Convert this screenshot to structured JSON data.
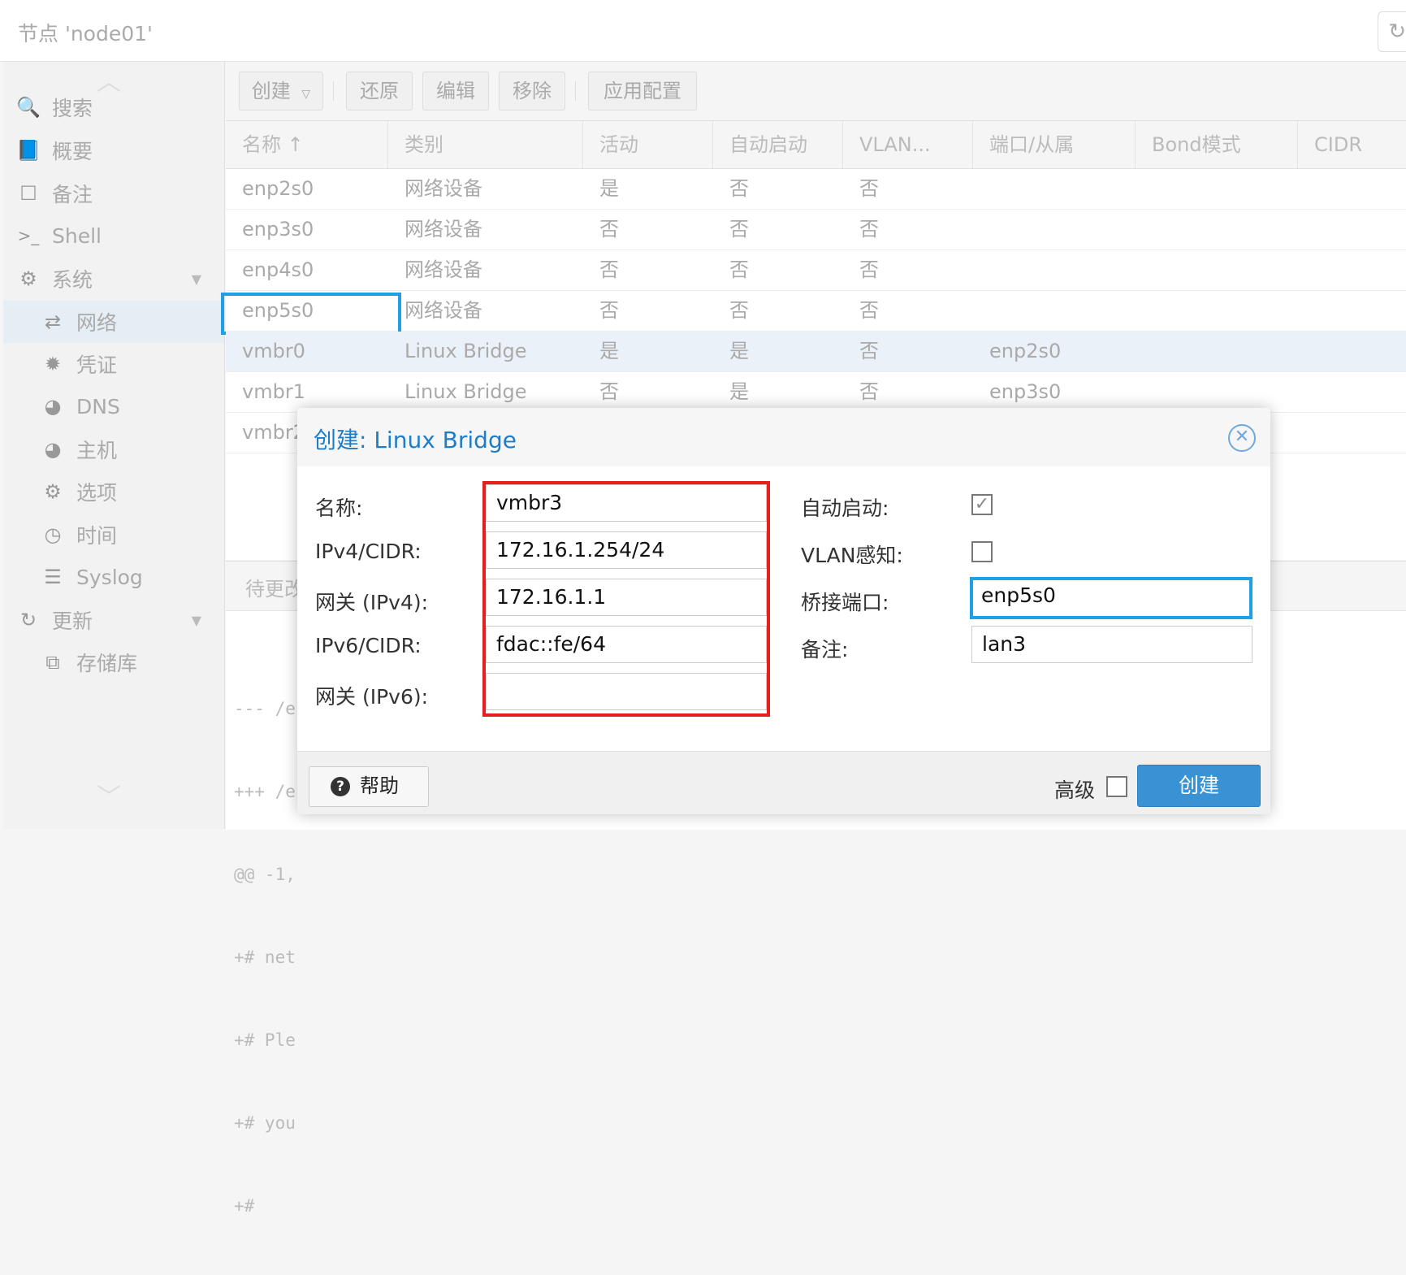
{
  "header": {
    "title": "节点 'node01'",
    "reload_icon": "↻"
  },
  "nav": {
    "items": [
      {
        "icon": "🔍",
        "icon_name": "search-icon",
        "label": "搜索"
      },
      {
        "icon": "📘",
        "icon_name": "book-icon",
        "label": "概要"
      },
      {
        "icon": "☐",
        "icon_name": "note-icon",
        "label": "备注"
      },
      {
        "icon": ">_",
        "icon_name": "terminal-icon",
        "label": "Shell"
      },
      {
        "icon": "⚙",
        "icon_name": "cogs-icon",
        "label": "系统"
      },
      {
        "icon": "⇄",
        "icon_name": "exchange-icon",
        "label": "网络"
      },
      {
        "icon": "✹",
        "icon_name": "certificate-icon",
        "label": "凭证"
      },
      {
        "icon": "◕",
        "icon_name": "globe-icon",
        "label": "DNS"
      },
      {
        "icon": "◕",
        "icon_name": "globe-icon",
        "label": "主机"
      },
      {
        "icon": "⚙",
        "icon_name": "gear-icon",
        "label": "选项"
      },
      {
        "icon": "◷",
        "icon_name": "clock-icon",
        "label": "时间"
      },
      {
        "icon": "☰",
        "icon_name": "list-icon",
        "label": "Syslog"
      },
      {
        "icon": "↻",
        "icon_name": "refresh-icon",
        "label": "更新"
      },
      {
        "icon": "⧉",
        "icon_name": "repository-icon",
        "label": "存储库"
      }
    ]
  },
  "toolbar": {
    "create": "创建",
    "revert": "还原",
    "edit": "编辑",
    "remove": "移除",
    "apply": "应用配置"
  },
  "grid": {
    "columns": [
      "名称 ↑",
      "类别",
      "活动",
      "自动启动",
      "VLAN...",
      "端口/从属",
      "Bond模式",
      "CIDR"
    ],
    "rows": [
      [
        "enp2s0",
        "网络设备",
        "是",
        "否",
        "否",
        ""
      ],
      [
        "enp3s0",
        "网络设备",
        "否",
        "否",
        "否",
        ""
      ],
      [
        "enp4s0",
        "网络设备",
        "否",
        "否",
        "否",
        ""
      ],
      [
        "enp5s0",
        "网络设备",
        "否",
        "否",
        "否",
        ""
      ],
      [
        "vmbr0",
        "Linux Bridge",
        "是",
        "是",
        "否",
        "enp2s0"
      ],
      [
        "vmbr1",
        "Linux Bridge",
        "否",
        "是",
        "否",
        "enp3s0"
      ],
      [
        "vmbr2",
        "",
        "",
        "",
        "",
        ""
      ]
    ]
  },
  "pending": {
    "title": "待更改",
    "diff": [
      "--- /e",
      "+++ /e",
      "@@ -1,",
      "+# net",
      "+# Ple",
      "+# you",
      "+#"
    ]
  },
  "dialog": {
    "title": "创建: Linux Bridge",
    "fields": {
      "name_label": "名称:",
      "name_value": "vmbr3",
      "ipv4_label": "IPv4/CIDR:",
      "ipv4_value": "172.16.1.254/24",
      "gw4_label": "网关 (IPv4):",
      "gw4_value": "172.16.1.1",
      "ipv6_label": "IPv6/CIDR:",
      "ipv6_value": "fdac::fe/64",
      "gw6_label": "网关 (IPv6):",
      "gw6_value": "",
      "autostart_label": "自动启动:",
      "autostart_checked": true,
      "vlan_label": "VLAN感知:",
      "vlan_checked": false,
      "ports_label": "桥接端口:",
      "ports_value": "enp5s0",
      "comment_label": "备注:",
      "comment_value": "lan3"
    },
    "help": "帮助",
    "advanced": "高级",
    "create": "创建"
  }
}
